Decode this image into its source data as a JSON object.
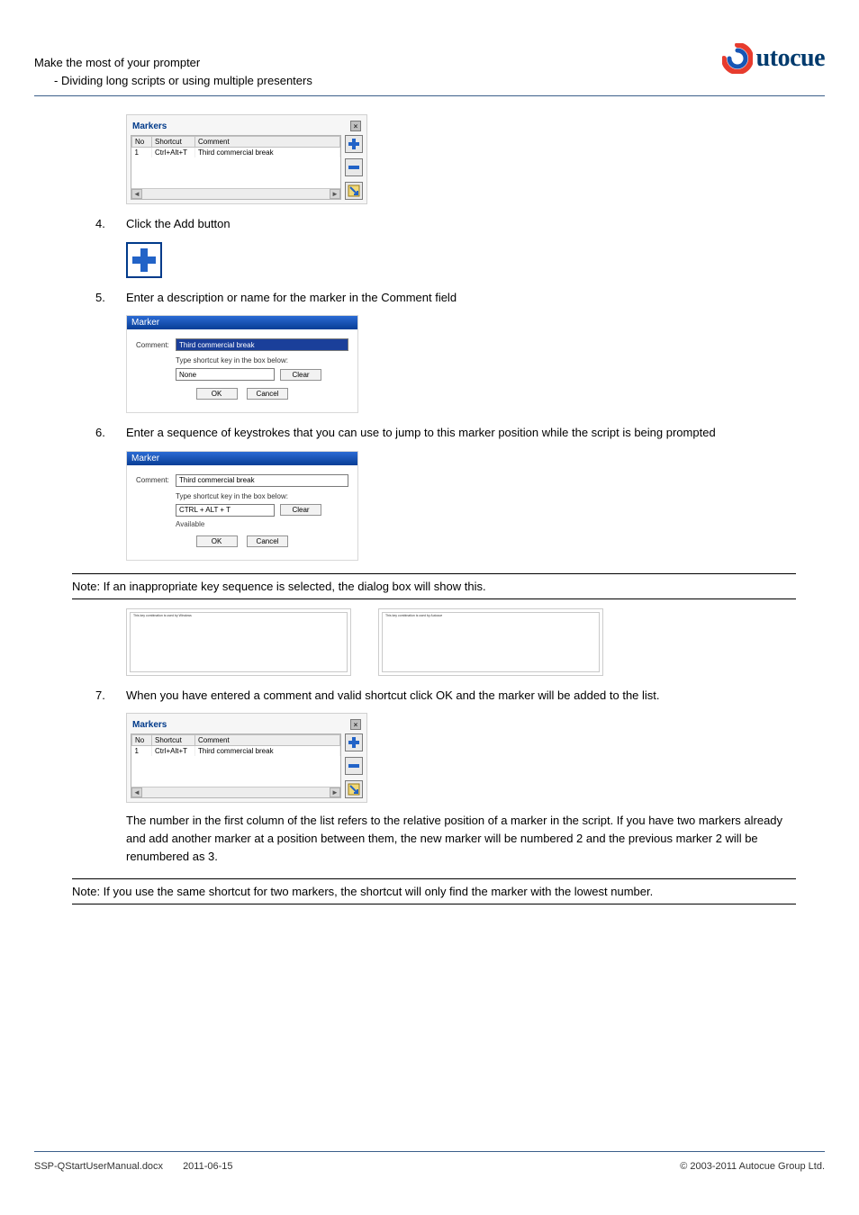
{
  "header": {
    "line1": "Make the most of your prompter",
    "line2": "- Dividing long scripts or using multiple presenters",
    "logo_text": "utocue"
  },
  "steps": {
    "s4_num": "4.",
    "s4_text": "Click the Add button",
    "s5_num": "5.",
    "s5_text": "Enter a description or name for the marker in the Comment field",
    "s6_num": "6.",
    "s6_text": "Enter a sequence of keystrokes that you can use to jump to this marker position while the script is being prompted",
    "s7_num": "7.",
    "s7_text": "When you have entered a comment and valid shortcut click OK and the marker will be added to the list."
  },
  "markers_dialog": {
    "title": "Markers",
    "cols": {
      "no": "No",
      "shortcut": "Shortcut",
      "comment": "Comment"
    },
    "row": {
      "no": "1",
      "shortcut": "Ctrl+Alt+T",
      "comment": "Third commercial break"
    }
  },
  "marker_dialog1": {
    "title": "Marker",
    "comment_label": "Comment:",
    "comment_value": "Third commercial break",
    "hint": "Type shortcut key in the box below:",
    "shortcut_value": "None",
    "clear": "Clear",
    "ok": "OK",
    "cancel": "Cancel"
  },
  "marker_dialog2": {
    "title": "Marker",
    "comment_label": "Comment:",
    "comment_value": "Third commercial break",
    "hint": "Type shortcut key in the box below:",
    "shortcut_value": "CTRL + ALT + T",
    "available": "Available",
    "clear": "Clear",
    "ok": "OK",
    "cancel": "Cancel"
  },
  "note1": "Note: If an inappropriate key sequence is selected, the dialog box will show this.",
  "note2": "Note: If you use the same shortcut for two markers, the shortcut will only find the marker with the lowest number.",
  "shots": {
    "left_text": "This key combination is used by Windows",
    "right_text": "This key combination is used by Autocue"
  },
  "para_text": "The number in the first column of the list refers to the relative position of a marker in the script. If you have two markers already and add another marker at a position between them, the new marker will be numbered 2 and the previous marker 2 will be renumbered as 3.",
  "footer": {
    "doc": "SSP-QStartUserManual.docx",
    "date": "2011-06-15",
    "copyright": "© 2003-2011 Autocue Group Ltd."
  }
}
